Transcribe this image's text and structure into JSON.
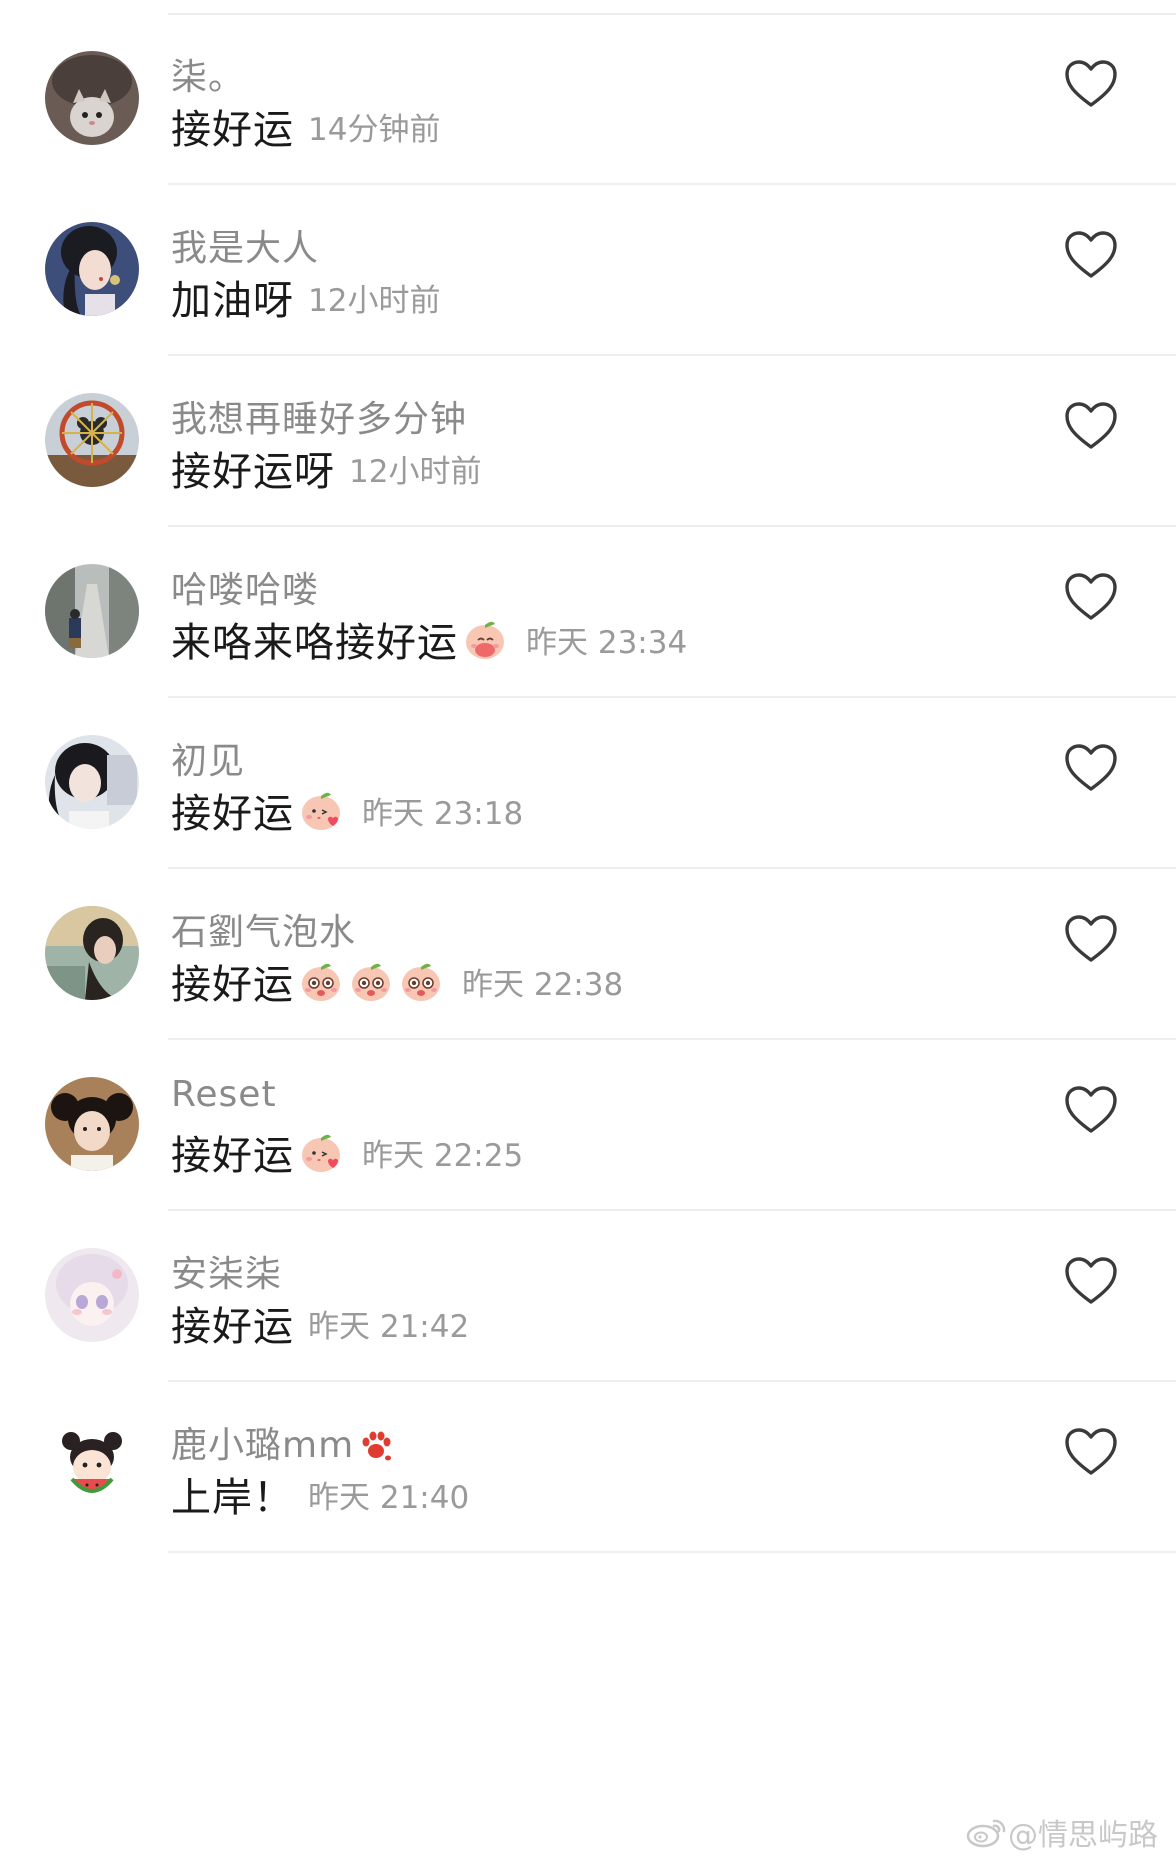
{
  "comments": [
    {
      "username": "柒。",
      "text": "接好运",
      "emoji_count": 0,
      "emoji_icon": "",
      "timestamp": "14分钟前",
      "avatar_icon": "cat-avatar"
    },
    {
      "username": "我是大人",
      "text": "加油呀",
      "emoji_count": 0,
      "emoji_icon": "",
      "timestamp": "12小时前",
      "avatar_icon": "illustrated-girl-avatar"
    },
    {
      "username": "我想再睡好多分钟",
      "text": "接好运呀",
      "emoji_count": 0,
      "emoji_icon": "",
      "timestamp": "12小时前",
      "avatar_icon": "ferris-wheel-avatar"
    },
    {
      "username": "哈喽哈喽",
      "text": "来咯来咯接好运",
      "emoji_count": 1,
      "emoji_icon": "peach-pray-emoji",
      "timestamp": "昨天 23:34",
      "avatar_icon": "street-scene-avatar"
    },
    {
      "username": "初见",
      "text": "接好运",
      "emoji_count": 1,
      "emoji_icon": "peach-kiss-emoji",
      "timestamp": "昨天 23:18",
      "avatar_icon": "girl-photo-avatar"
    },
    {
      "username": "石劉气泡水",
      "text": "接好运",
      "emoji_count": 3,
      "emoji_icon": "peach-starry-eyes-emoji",
      "timestamp": "昨天 22:38",
      "avatar_icon": "sunset-girl-avatar"
    },
    {
      "username": "Reset",
      "text": "接好运",
      "emoji_count": 1,
      "emoji_icon": "peach-kiss-emoji",
      "timestamp": "昨天 22:25",
      "avatar_icon": "pigtail-girl-avatar"
    },
    {
      "username": "安柒柒",
      "text": "接好运",
      "emoji_count": 0,
      "emoji_icon": "",
      "timestamp": "昨天 21:42",
      "avatar_icon": "anime-girl-avatar"
    },
    {
      "username": "鹿小璐mm",
      "text": "上岸！",
      "emoji_count": 0,
      "emoji_icon": "",
      "timestamp": "昨天 21:40",
      "avatar_icon": "watermelon-girl-avatar",
      "username_icon": "paw-print-icon"
    }
  ],
  "watermark": {
    "text": "@情思屿路",
    "icon": "weibo-icon"
  },
  "colors": {
    "username": "#8a8a8a",
    "text": "#1a1a1a",
    "timestamp": "#9a9a9a",
    "divider": "#eeeeee",
    "heart_stroke": "#3a3a3a"
  }
}
